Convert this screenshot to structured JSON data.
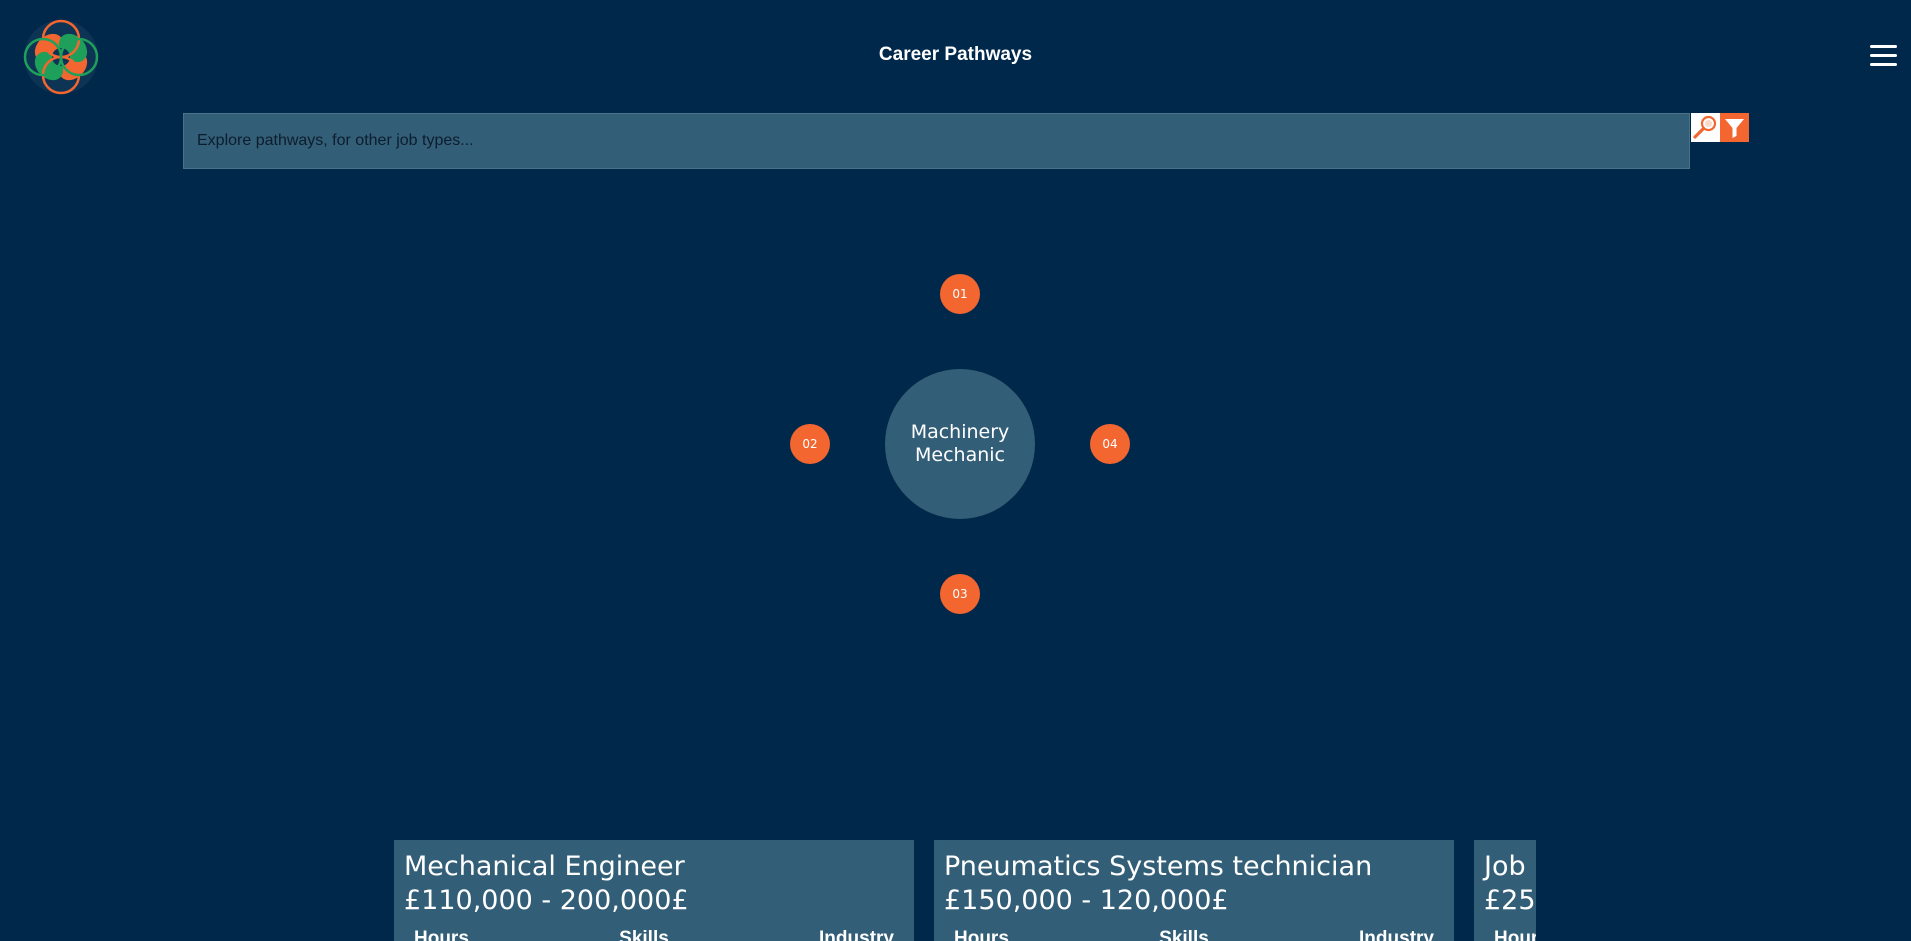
{
  "header": {
    "title": "Career Pathways"
  },
  "search": {
    "placeholder": "Explore pathways, for other job types...",
    "value": ""
  },
  "pathway": {
    "center_label": "Machinery Mechanic",
    "steps": [
      "01",
      "02",
      "03",
      "04"
    ]
  },
  "cards": [
    {
      "title": "Mechanical Engineer",
      "salary": "£110,000 - 200,000£",
      "col_hours": "Hours",
      "col_skills": "Skills",
      "col_industry": "Industry"
    },
    {
      "title": "Pneumatics Systems technician",
      "salary": "£150,000 - 120,000£",
      "col_hours": "Hours",
      "col_skills": "Skills",
      "col_industry": "Industry"
    },
    {
      "title": "Job",
      "salary": "£25",
      "col_hours": "Hour"
    }
  ],
  "colors": {
    "background": "#00284b",
    "panel": "#335e77",
    "accent_orange": "#f3662f",
    "accent_green": "#1ea05a"
  },
  "icons": {
    "logo": "interlocking-rings-logo",
    "menu": "hamburger-menu-icon",
    "search": "magnifier-icon",
    "filter": "funnel-filter-icon"
  }
}
